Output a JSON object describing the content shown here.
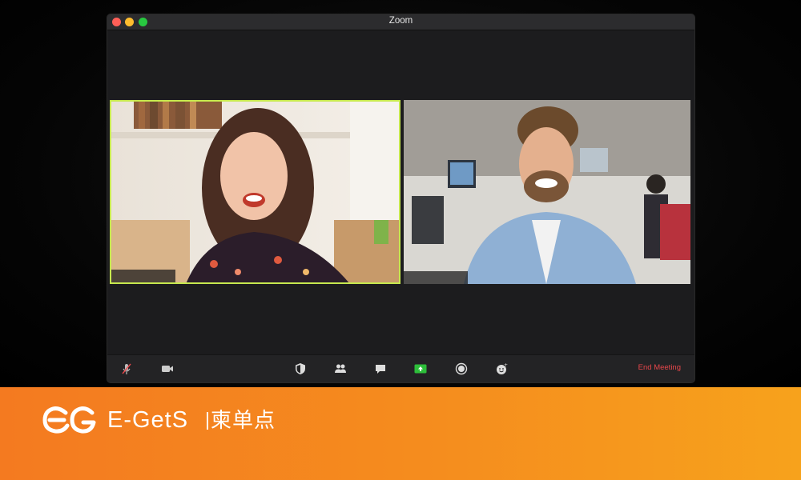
{
  "window": {
    "title": "Zoom",
    "controls": [
      "close",
      "minimize",
      "zoom"
    ]
  },
  "participants": [
    {
      "position": "left",
      "active_speaker": true,
      "description": "woman laughing"
    },
    {
      "position": "right",
      "active_speaker": false,
      "description": "man smiling in office"
    }
  ],
  "toolbar": {
    "icons": [
      "mute-microphone-icon",
      "video-camera-icon",
      "security-shield-icon",
      "participants-icon",
      "chat-icon",
      "share-screen-icon",
      "record-icon",
      "reactions-icon"
    ],
    "end_meeting_label": "End Meeting"
  },
  "colors": {
    "active_speaker_border": "#c6e84e",
    "share_screen": "#2dbe3a",
    "end_meeting": "#e8474b",
    "banner_start": "#f47a20",
    "banner_end": "#f7a21c"
  },
  "banner": {
    "brand_en": "E-GetS",
    "brand_cn": "柬单点"
  }
}
